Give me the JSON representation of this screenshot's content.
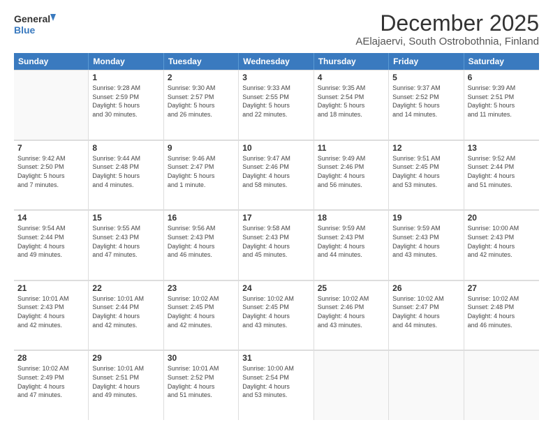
{
  "header": {
    "logo_line1": "General",
    "logo_line2": "Blue",
    "title": "December 2025",
    "subtitle": "AElajaervi, South Ostrobothnia, Finland"
  },
  "calendar": {
    "weekdays": [
      "Sunday",
      "Monday",
      "Tuesday",
      "Wednesday",
      "Thursday",
      "Friday",
      "Saturday"
    ],
    "rows": [
      [
        {
          "day": "",
          "info": ""
        },
        {
          "day": "1",
          "info": "Sunrise: 9:28 AM\nSunset: 2:59 PM\nDaylight: 5 hours\nand 30 minutes."
        },
        {
          "day": "2",
          "info": "Sunrise: 9:30 AM\nSunset: 2:57 PM\nDaylight: 5 hours\nand 26 minutes."
        },
        {
          "day": "3",
          "info": "Sunrise: 9:33 AM\nSunset: 2:55 PM\nDaylight: 5 hours\nand 22 minutes."
        },
        {
          "day": "4",
          "info": "Sunrise: 9:35 AM\nSunset: 2:54 PM\nDaylight: 5 hours\nand 18 minutes."
        },
        {
          "day": "5",
          "info": "Sunrise: 9:37 AM\nSunset: 2:52 PM\nDaylight: 5 hours\nand 14 minutes."
        },
        {
          "day": "6",
          "info": "Sunrise: 9:39 AM\nSunset: 2:51 PM\nDaylight: 5 hours\nand 11 minutes."
        }
      ],
      [
        {
          "day": "7",
          "info": "Sunrise: 9:42 AM\nSunset: 2:50 PM\nDaylight: 5 hours\nand 7 minutes."
        },
        {
          "day": "8",
          "info": "Sunrise: 9:44 AM\nSunset: 2:48 PM\nDaylight: 5 hours\nand 4 minutes."
        },
        {
          "day": "9",
          "info": "Sunrise: 9:46 AM\nSunset: 2:47 PM\nDaylight: 5 hours\nand 1 minute."
        },
        {
          "day": "10",
          "info": "Sunrise: 9:47 AM\nSunset: 2:46 PM\nDaylight: 4 hours\nand 58 minutes."
        },
        {
          "day": "11",
          "info": "Sunrise: 9:49 AM\nSunset: 2:46 PM\nDaylight: 4 hours\nand 56 minutes."
        },
        {
          "day": "12",
          "info": "Sunrise: 9:51 AM\nSunset: 2:45 PM\nDaylight: 4 hours\nand 53 minutes."
        },
        {
          "day": "13",
          "info": "Sunrise: 9:52 AM\nSunset: 2:44 PM\nDaylight: 4 hours\nand 51 minutes."
        }
      ],
      [
        {
          "day": "14",
          "info": "Sunrise: 9:54 AM\nSunset: 2:44 PM\nDaylight: 4 hours\nand 49 minutes."
        },
        {
          "day": "15",
          "info": "Sunrise: 9:55 AM\nSunset: 2:43 PM\nDaylight: 4 hours\nand 47 minutes."
        },
        {
          "day": "16",
          "info": "Sunrise: 9:56 AM\nSunset: 2:43 PM\nDaylight: 4 hours\nand 46 minutes."
        },
        {
          "day": "17",
          "info": "Sunrise: 9:58 AM\nSunset: 2:43 PM\nDaylight: 4 hours\nand 45 minutes."
        },
        {
          "day": "18",
          "info": "Sunrise: 9:59 AM\nSunset: 2:43 PM\nDaylight: 4 hours\nand 44 minutes."
        },
        {
          "day": "19",
          "info": "Sunrise: 9:59 AM\nSunset: 2:43 PM\nDaylight: 4 hours\nand 43 minutes."
        },
        {
          "day": "20",
          "info": "Sunrise: 10:00 AM\nSunset: 2:43 PM\nDaylight: 4 hours\nand 42 minutes."
        }
      ],
      [
        {
          "day": "21",
          "info": "Sunrise: 10:01 AM\nSunset: 2:43 PM\nDaylight: 4 hours\nand 42 minutes."
        },
        {
          "day": "22",
          "info": "Sunrise: 10:01 AM\nSunset: 2:44 PM\nDaylight: 4 hours\nand 42 minutes."
        },
        {
          "day": "23",
          "info": "Sunrise: 10:02 AM\nSunset: 2:45 PM\nDaylight: 4 hours\nand 42 minutes."
        },
        {
          "day": "24",
          "info": "Sunrise: 10:02 AM\nSunset: 2:45 PM\nDaylight: 4 hours\nand 43 minutes."
        },
        {
          "day": "25",
          "info": "Sunrise: 10:02 AM\nSunset: 2:46 PM\nDaylight: 4 hours\nand 43 minutes."
        },
        {
          "day": "26",
          "info": "Sunrise: 10:02 AM\nSunset: 2:47 PM\nDaylight: 4 hours\nand 44 minutes."
        },
        {
          "day": "27",
          "info": "Sunrise: 10:02 AM\nSunset: 2:48 PM\nDaylight: 4 hours\nand 46 minutes."
        }
      ],
      [
        {
          "day": "28",
          "info": "Sunrise: 10:02 AM\nSunset: 2:49 PM\nDaylight: 4 hours\nand 47 minutes."
        },
        {
          "day": "29",
          "info": "Sunrise: 10:01 AM\nSunset: 2:51 PM\nDaylight: 4 hours\nand 49 minutes."
        },
        {
          "day": "30",
          "info": "Sunrise: 10:01 AM\nSunset: 2:52 PM\nDaylight: 4 hours\nand 51 minutes."
        },
        {
          "day": "31",
          "info": "Sunrise: 10:00 AM\nSunset: 2:54 PM\nDaylight: 4 hours\nand 53 minutes."
        },
        {
          "day": "",
          "info": ""
        },
        {
          "day": "",
          "info": ""
        },
        {
          "day": "",
          "info": ""
        }
      ]
    ]
  }
}
